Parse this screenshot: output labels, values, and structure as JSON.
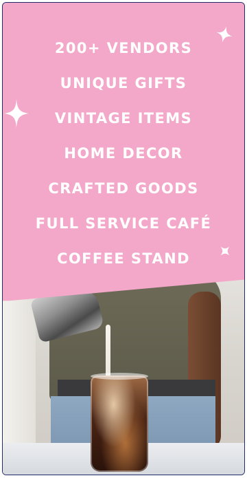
{
  "colors": {
    "panel": "#f3a8c9",
    "text": "#ffffff",
    "border": "#1f2a66"
  },
  "features": [
    {
      "label": "200+ VENDORS"
    },
    {
      "label": "UNIQUE GIFTS"
    },
    {
      "label": "VINTAGE ITEMS"
    },
    {
      "label": "HOME DECOR"
    },
    {
      "label": "CRAFTED GOODS"
    },
    {
      "label": "FULL SERVICE CAFÉ"
    },
    {
      "label": "COFFEE STAND"
    }
  ],
  "icons": [
    "sparkle-icon",
    "sparkle-icon",
    "sparkle-icon"
  ],
  "photo": {
    "subject": "coffee-pour-photo"
  }
}
